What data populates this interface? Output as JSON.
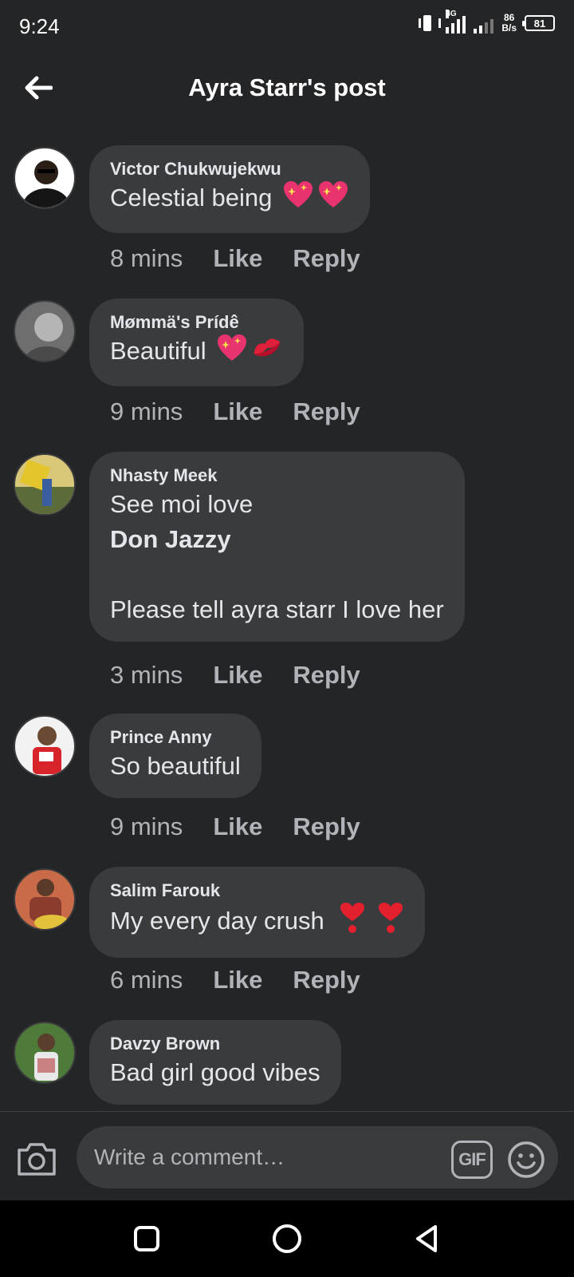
{
  "status_bar": {
    "time": "9:24",
    "network_label": "4G",
    "net_rate": "86",
    "net_rate_unit": "B/s",
    "battery": "81"
  },
  "header": {
    "title": "Ayra Starr's post",
    "back_icon": "back-arrow-icon"
  },
  "comments": [
    {
      "author": "Victor Chukwujekwu",
      "lines": [
        "Celestial being"
      ],
      "emojis": [
        "sparkling-heart",
        "sparkling-heart"
      ],
      "time": "8 mins",
      "like_label": "Like",
      "reply_label": "Reply",
      "avatar_color": "#1c1c1c"
    },
    {
      "author": "Mømmä's Prídê",
      "lines": [
        "Beautiful"
      ],
      "emojis": [
        "sparkling-heart",
        "kiss-mark"
      ],
      "time": "9 mins",
      "like_label": "Like",
      "reply_label": "Reply",
      "avatar_color": "#8a8a8a"
    },
    {
      "author": "Nhasty Meek",
      "lines": [
        "See moi love",
        "Don Jazzy",
        "",
        "Please tell ayra starr I love her"
      ],
      "emojis": [],
      "time": "3 mins",
      "like_label": "Like",
      "reply_label": "Reply",
      "avatar_color": "#c9b45a"
    },
    {
      "author": "Prince Anny",
      "lines": [
        "So beautiful"
      ],
      "emojis": [],
      "time": "9 mins",
      "like_label": "Like",
      "reply_label": "Reply",
      "avatar_color": "#c0392b"
    },
    {
      "author": "Salim Farouk",
      "lines": [
        "My every day crush"
      ],
      "emojis": [
        "heart-exclamation",
        "heart-exclamation"
      ],
      "time": "6 mins",
      "like_label": "Like",
      "reply_label": "Reply",
      "avatar_color": "#b5553a"
    },
    {
      "author": "Davzy Brown",
      "lines": [
        "Bad girl good vibes"
      ],
      "emojis": [],
      "avatar_color": "#6b8e4e"
    }
  ],
  "composer": {
    "placeholder": "Write a comment…",
    "gif_label": "GIF"
  },
  "colors": {
    "background": "#242526",
    "bubble": "#3a3b3c",
    "text": "#e4e6eb",
    "secondary_text": "#b0b3b8"
  }
}
